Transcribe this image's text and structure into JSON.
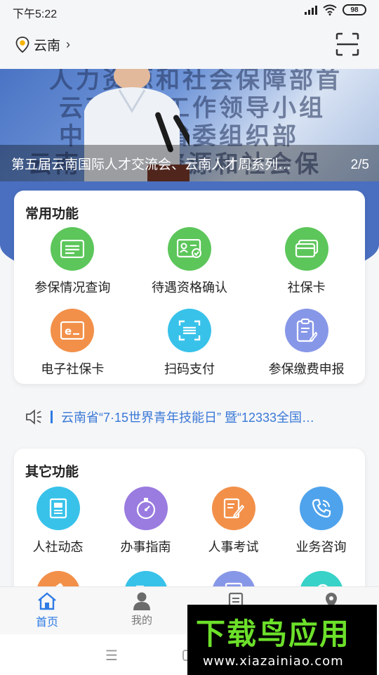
{
  "status": {
    "time": "下午5:22",
    "battery": "98"
  },
  "header": {
    "location": "云南",
    "chevron": "›"
  },
  "banner": {
    "caption": "第五届云南国际人才交流会、云南人才周系列…",
    "page": "2/5",
    "bg_lines": [
      "人力资源和社会保障部首",
      "云南人才工作领导小组",
      "中共云南省委组织部",
      "云南省人力资源和社会保"
    ]
  },
  "common": {
    "title": "常用功能",
    "items": [
      {
        "label": "参保情况查询",
        "icon": "list-card-icon",
        "color": "#5cc65a"
      },
      {
        "label": "待遇资格确认",
        "icon": "id-check-icon",
        "color": "#5cc65a"
      },
      {
        "label": "社保卡",
        "icon": "card-icon",
        "color": "#5cc65a"
      },
      {
        "label": "电子社保卡",
        "icon": "e-card-icon",
        "color": "#f2904a"
      },
      {
        "label": "扫码支付",
        "icon": "scan-icon",
        "color": "#38c2ea"
      },
      {
        "label": "参保缴费申报",
        "icon": "clipboard-icon",
        "color": "#8797e8"
      }
    ]
  },
  "notice": {
    "text": "云南省“7·15世界青年技能日” 暨“12333全国…"
  },
  "other": {
    "title": "其它功能",
    "items": [
      {
        "label": "人社动态",
        "icon": "news-icon",
        "color": "#38c2ea"
      },
      {
        "label": "办事指南",
        "icon": "compass-icon",
        "color": "#9a7be0"
      },
      {
        "label": "人事考试",
        "icon": "exam-icon",
        "color": "#f2904a"
      },
      {
        "label": "业务咨询",
        "icon": "phone-icon",
        "color": "#4fa3ec"
      },
      {
        "label": "",
        "icon": "gavel-icon",
        "color": "#f2904a"
      },
      {
        "label": "",
        "icon": "folder-icon",
        "color": "#38c2ea"
      },
      {
        "label": "",
        "icon": "recruit-icon",
        "color": "#8797e8"
      },
      {
        "label": "",
        "icon": "search-icon",
        "color": "#38d2c8"
      }
    ]
  },
  "nav": {
    "items": [
      {
        "label": "首页",
        "icon": "home-icon",
        "active": true
      },
      {
        "label": "我的",
        "icon": "user-icon",
        "active": false
      },
      {
        "label": "",
        "icon": "doc-icon",
        "active": false
      },
      {
        "label": "",
        "icon": "location-icon",
        "active": false
      }
    ]
  },
  "watermark": {
    "title": "下载鸟应用",
    "url": "www.xiazainiao.com"
  }
}
